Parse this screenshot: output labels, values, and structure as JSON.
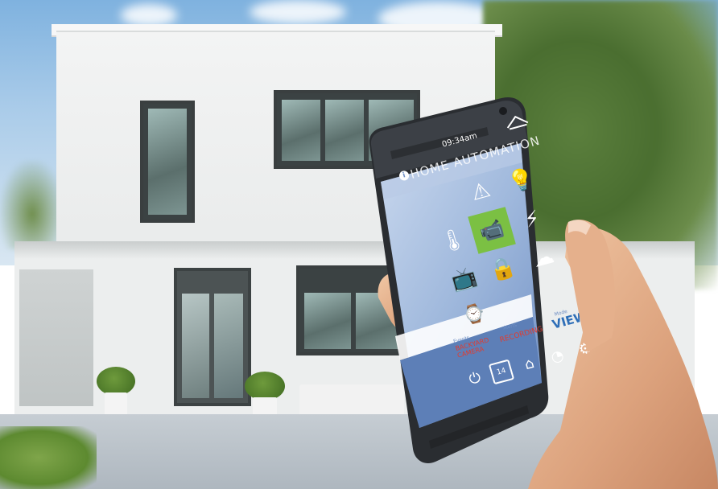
{
  "phone_screen": {
    "status_time": "09:34am",
    "app_title": "HOME AUTOMATION",
    "info_icon": "info-icon",
    "brand_logo": "house-logo",
    "tiles": [
      {
        "name": "alarm-siren-icon"
      },
      {
        "name": "light-bulb-icon"
      },
      {
        "name": "thermometer-icon"
      },
      {
        "name": "security-camera-icon"
      },
      {
        "name": "lightning-icon"
      },
      {
        "name": "tv-icon"
      },
      {
        "name": "lock-icon"
      },
      {
        "name": "cloud-download-icon"
      },
      {
        "name": "washing-machine-icon"
      }
    ],
    "info_bar": {
      "col1_small": "Events",
      "col1_main": "BACKYARD CAMERA",
      "col2_small": "Alerts",
      "col2_main": "RECORDING",
      "col3_small": "Mode",
      "col3_main": "VIEW"
    },
    "bottom_nav": [
      {
        "name": "power-icon"
      },
      {
        "name": "calendar-icon",
        "badge": "14"
      },
      {
        "name": "home-icon"
      },
      {
        "name": "speedometer-icon"
      },
      {
        "name": "settings-gear-icon"
      }
    ]
  },
  "colors": {
    "screen_bg": "#9fb8dc",
    "tile_highlight": "#7bc043",
    "accent_red": "#e23b2e",
    "accent_blue": "#2f6fb8"
  }
}
